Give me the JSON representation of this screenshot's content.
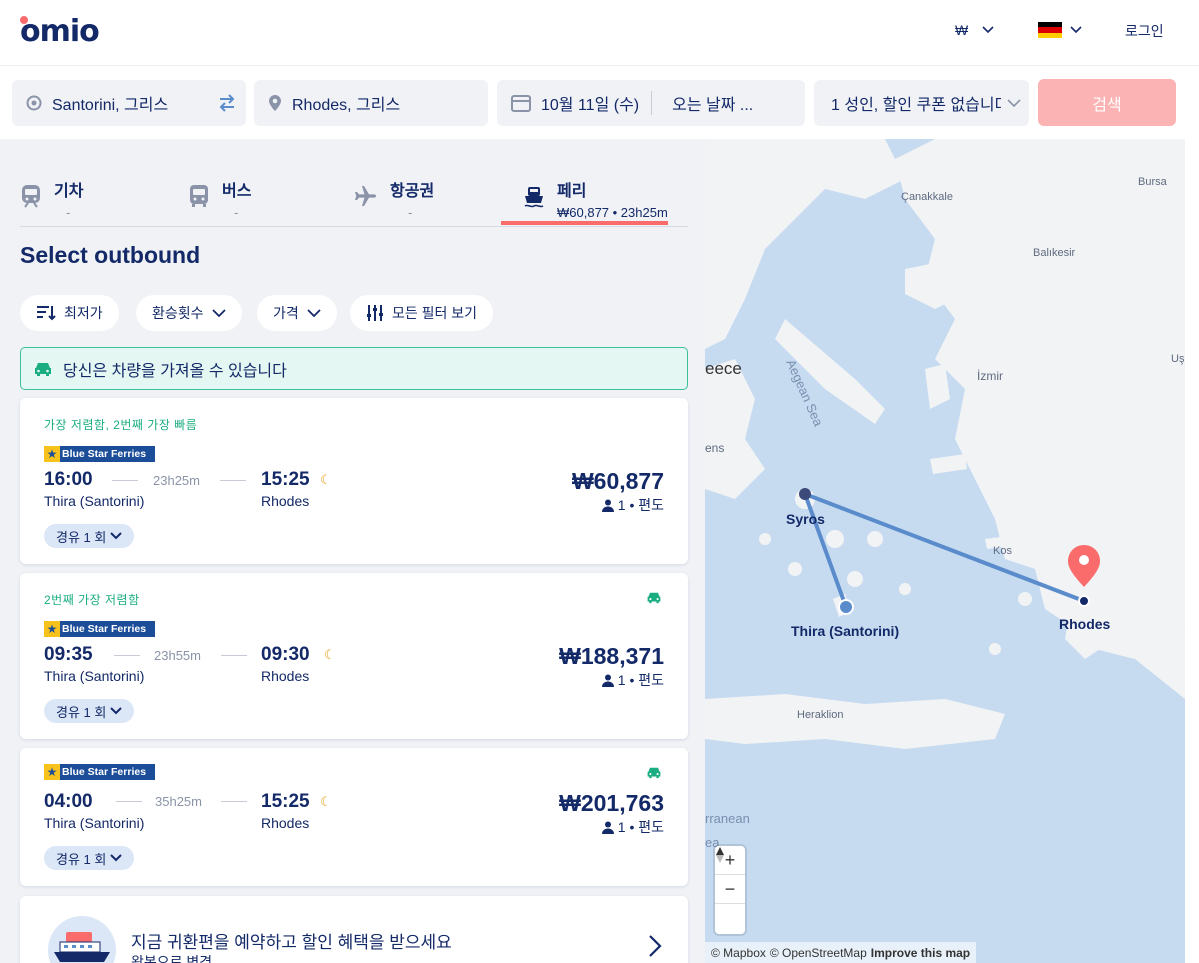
{
  "brand": {
    "logo_text": "omio"
  },
  "header": {
    "currency": "₩",
    "language_flag": "germany-flag",
    "login_label": "로그인"
  },
  "search": {
    "origin": "Santorini, 그리스",
    "destination": "Rhodes, 그리스",
    "departure_date": "10월 11일 (수)",
    "return_date_placeholder": "오는 날짜 ...",
    "passengers": "1 성인, 할인 쿠폰 없습니다",
    "search_button": "검색"
  },
  "tabs": [
    {
      "label": "기차",
      "sub": "-",
      "icon": "train-icon"
    },
    {
      "label": "버스",
      "sub": "-",
      "icon": "bus-icon"
    },
    {
      "label": "항공권",
      "sub": "-",
      "icon": "plane-icon"
    },
    {
      "label": "페리",
      "sub": "₩60,877 • 23h25m",
      "icon": "ferry-icon",
      "active": true
    }
  ],
  "heading": "Select outbound",
  "filters": {
    "sort": "최저가",
    "transfers": "환승횟수",
    "price": "가격",
    "all_filters": "모든 필터 보기"
  },
  "notice": "당신은 차량을 가져올 수 있습니다",
  "results": [
    {
      "tag": "가장 저렴함, 2번째 가장 빠름",
      "operator": "Blue Star Ferries",
      "depart_time": "16:00",
      "duration": "23h25m",
      "arrive_time": "15:25",
      "origin_station": "Thira (Santorini)",
      "dest_station": "Rhodes",
      "price": "₩60,877",
      "pax": "1 • 편도",
      "stops": "경유 1 회",
      "car_icon": false
    },
    {
      "tag": "2번째 가장 저렴함",
      "operator": "Blue Star Ferries",
      "depart_time": "09:35",
      "duration": "23h55m",
      "arrive_time": "09:30",
      "origin_station": "Thira (Santorini)",
      "dest_station": "Rhodes",
      "price": "₩188,371",
      "pax": "1 • 편도",
      "stops": "경유 1 회",
      "car_icon": true
    },
    {
      "tag": "",
      "operator": "Blue Star Ferries",
      "depart_time": "04:00",
      "duration": "35h25m",
      "arrive_time": "15:25",
      "origin_station": "Thira (Santorini)",
      "dest_station": "Rhodes",
      "price": "₩201,763",
      "pax": "1 • 편도",
      "stops": "경유 1 회",
      "car_icon": true
    }
  ],
  "return_promo": {
    "title": "지금 귀환편을 예약하고 할인 혜택을 받으세요",
    "subtitle": "왕복으로 변경"
  },
  "map": {
    "labels": [
      "Çanakkale",
      "Bursa",
      "Balıkesir",
      "Aegean Sea",
      "eece",
      "İzmir",
      "Uş",
      "ens",
      "Kos",
      "Heraklion",
      "rranean",
      "ea"
    ],
    "cities": [
      "Syros",
      "Thira (Santorini)",
      "Rhodes"
    ],
    "zoom_in": "+",
    "zoom_out": "−",
    "attribution_mapbox": "© Mapbox",
    "attribution_osm": "© OpenStreetMap",
    "improve": "Improve this map"
  },
  "colors": {
    "primary": "#132968",
    "accent": "#fa6b6b",
    "green": "#1aad81",
    "route": "#5a8ccc"
  }
}
